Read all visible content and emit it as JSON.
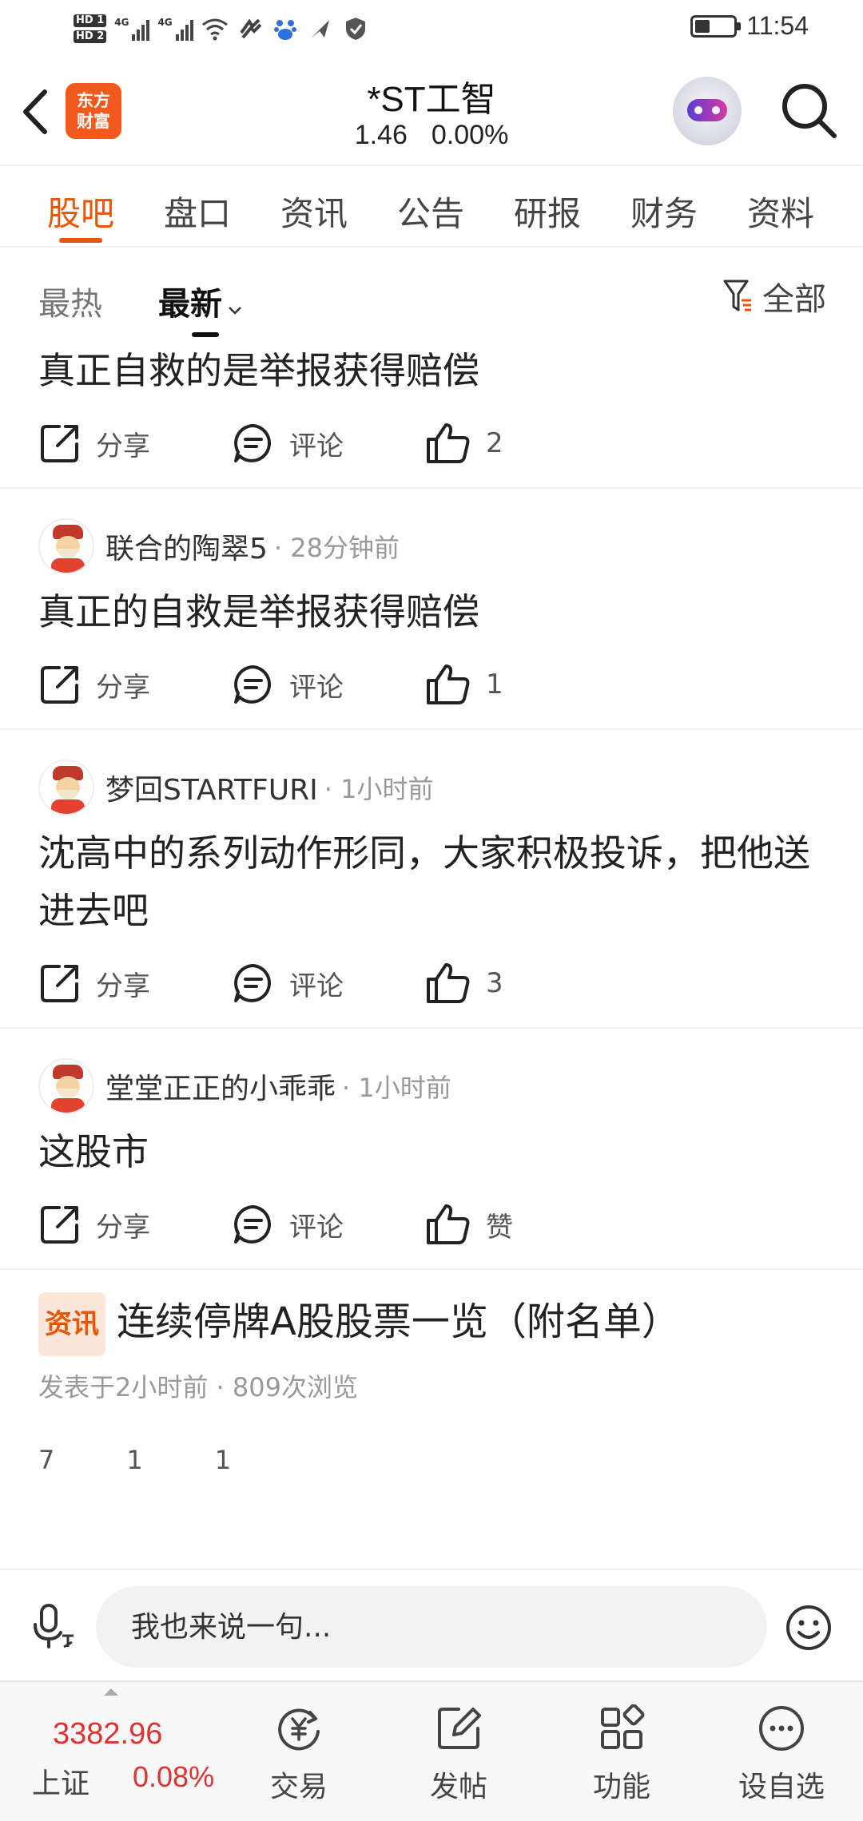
{
  "status_bar": {
    "hd1": "HD 1",
    "hd2": "HD 2",
    "network1": "4G",
    "network2": "4G",
    "time": "11:54",
    "battery_level": 0.3,
    "icons": [
      "wifi-icon",
      "sync-icon",
      "baidu-icon",
      "send-icon",
      "shield-icon"
    ]
  },
  "header": {
    "logo_line1": "东方",
    "logo_line2": "财富",
    "stock_name": "*ST工智",
    "price": "1.46",
    "change_pct": "0.00%"
  },
  "tabs": [
    {
      "label": "股吧",
      "active": true
    },
    {
      "label": "盘口",
      "active": false
    },
    {
      "label": "资讯",
      "active": false
    },
    {
      "label": "公告",
      "active": false
    },
    {
      "label": "研报",
      "active": false
    },
    {
      "label": "财务",
      "active": false
    },
    {
      "label": "资料",
      "active": false
    }
  ],
  "sort": {
    "hot": "最热",
    "latest": "最新",
    "filter": "全部"
  },
  "posts": [
    {
      "author": "",
      "time": "",
      "text": "真正自救的是举报获得赔偿",
      "share": "分享",
      "comment": "评论",
      "likes": "2"
    },
    {
      "author": "联合的陶翠5",
      "time": "· 28分钟前",
      "text": "真正的自救是举报获得赔偿",
      "share": "分享",
      "comment": "评论",
      "likes": "1"
    },
    {
      "author": "梦回STARTFURI",
      "time": "· 1小时前",
      "text": "沈高中的系列动作形同，大家积极投诉，把他送进去吧",
      "share": "分享",
      "comment": "评论",
      "likes": "3"
    },
    {
      "author": "堂堂正正的小乖乖",
      "time": "· 1小时前",
      "text": "这股市",
      "share": "分享",
      "comment": "评论",
      "likes": "赞"
    }
  ],
  "news": {
    "badge": "资讯",
    "title": "连续停牌A股股票一览（附名单）",
    "meta": "发表于2小时前 · 809次浏览",
    "shares": "7",
    "comments": "1",
    "likes": "1"
  },
  "comment_bar": {
    "placeholder": "我也来说一句..."
  },
  "bottom_nav": {
    "index_value": "3382.96",
    "index_name": "上证",
    "index_pct": "0.08%",
    "items": [
      {
        "label": "交易",
        "icon": "trade-icon"
      },
      {
        "label": "发帖",
        "icon": "post-edit-icon"
      },
      {
        "label": "功能",
        "icon": "apps-icon"
      },
      {
        "label": "设自选",
        "icon": "more-icon"
      }
    ]
  },
  "colors": {
    "accent": "#ea5504",
    "up_red": "#e03131",
    "brand_logo": "#f25a1d"
  }
}
